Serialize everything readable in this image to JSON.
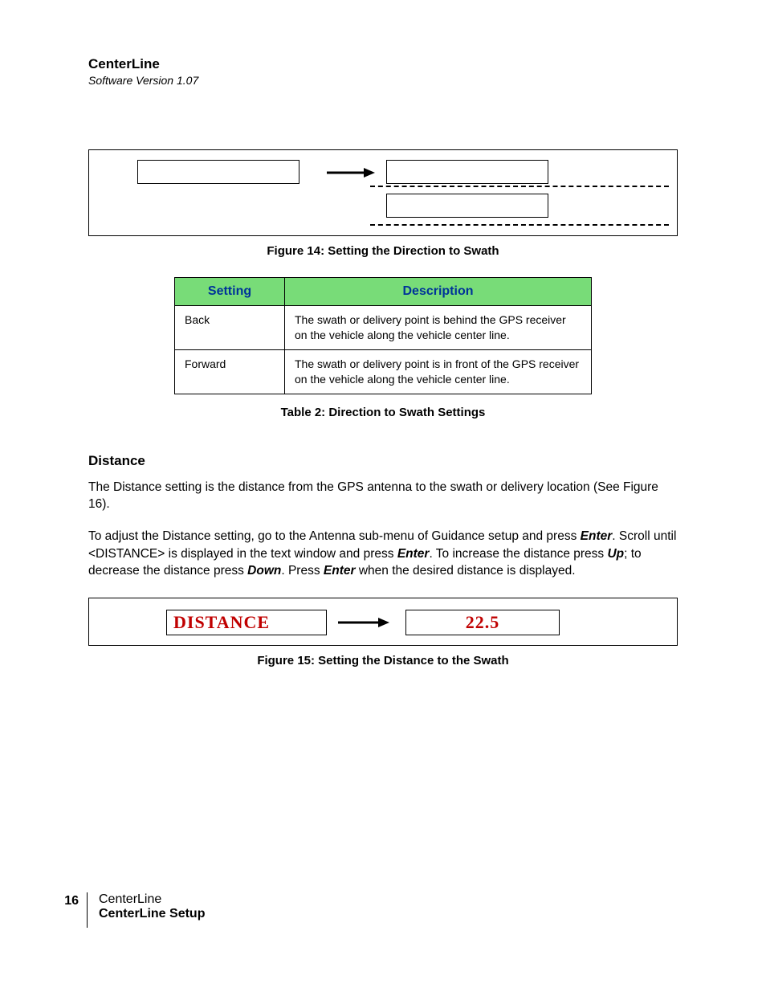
{
  "header": {
    "title": "CenterLine",
    "version": "Software Version 1.07"
  },
  "figure14": {
    "caption": "Figure 14: Setting the Direction to Swath"
  },
  "table2": {
    "head_setting": "Setting",
    "head_description": "Description",
    "rows": [
      {
        "setting": "Back",
        "desc": "The swath or delivery point is behind the GPS receiver on the vehicle along the vehicle center line."
      },
      {
        "setting": "Forward",
        "desc": "The swath or delivery point is in front of the GPS receiver on the vehicle along the vehicle center line."
      }
    ],
    "caption": "Table 2: Direction to Swath Settings"
  },
  "distance": {
    "heading": "Distance",
    "para1": "The Distance setting is the distance from the GPS antenna to the swath or delivery location (See Figure 16).",
    "p2_a": "To adjust the Distance setting, go to the Antenna sub-menu of Guidance setup and press ",
    "p2_enter": "Enter",
    "p2_b": ". Scroll until <DISTANCE> is displayed in the text window and press ",
    "p2_c": ". To increase the distance press ",
    "p2_up": "Up",
    "p2_d": "; to decrease the distance press ",
    "p2_down": "Down",
    "p2_e": ". Press ",
    "p2_f": " when the desired distance is displayed."
  },
  "figure15": {
    "lcd_left": "DISTANCE",
    "lcd_right": "22.5",
    "caption": "Figure 15: Setting the Distance to the Swath"
  },
  "footer": {
    "page": "16",
    "line1": "CenterLine",
    "line2": "CenterLine Setup"
  }
}
